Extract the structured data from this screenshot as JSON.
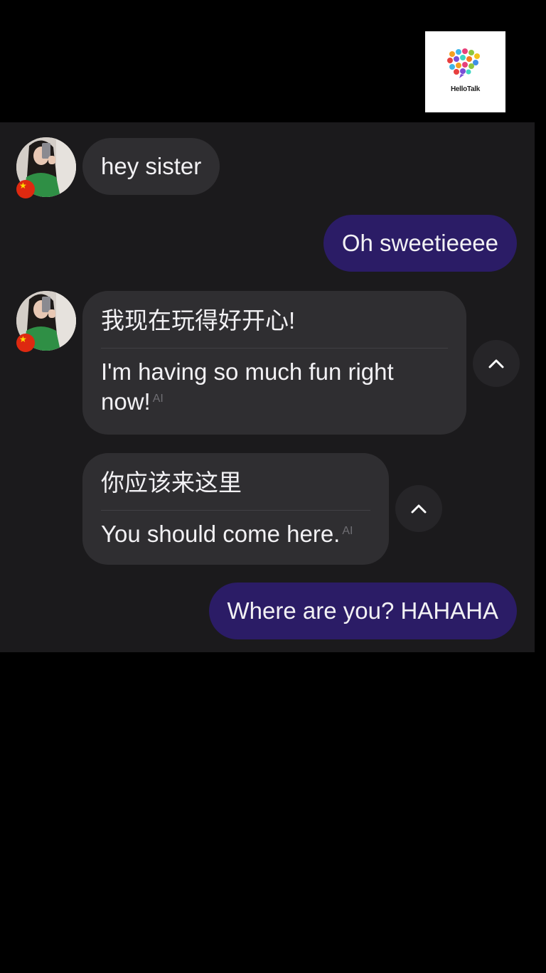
{
  "watermark": {
    "brand": "HelloTalk"
  },
  "messages": [
    {
      "id": "m1",
      "direction": "incoming",
      "text": "hey sister"
    },
    {
      "id": "m2",
      "direction": "outgoing",
      "text": "Oh sweetieeee"
    },
    {
      "id": "m3",
      "direction": "incoming",
      "original": "我现在玩得好开心!",
      "translation": "I'm having so much fun right now!",
      "ai_tag": "AI"
    },
    {
      "id": "m4",
      "direction": "incoming",
      "original": "你应该来这里",
      "translation": "You should come here.",
      "ai_tag": "AI"
    },
    {
      "id": "m5",
      "direction": "outgoing",
      "text": "Where are you? HAHAHA"
    }
  ],
  "icons": {
    "collapse": "chevron-up-icon",
    "flag": "china-flag-icon"
  },
  "colors": {
    "chat_background": "#1b1a1c",
    "incoming_bubble": "#2f2e31",
    "outgoing_bubble": "#2b1c66",
    "text": "#f2f1f4"
  }
}
